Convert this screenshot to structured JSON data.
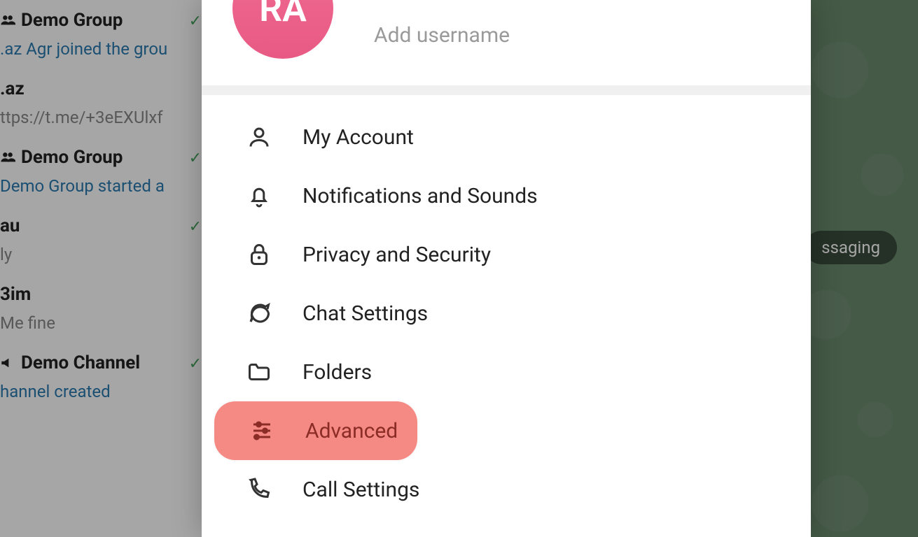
{
  "background": {
    "badge_text": "ssaging"
  },
  "chatlist": [
    {
      "icon": "group",
      "title": "Demo Group",
      "subtitle": ".az Agr joined the grou",
      "sub_color": "link",
      "check": true
    },
    {
      "icon": "",
      "title": ".az",
      "subtitle": "ttps://t.me/+3eEXUlxf",
      "sub_color": "gray",
      "check": false
    },
    {
      "icon": "group",
      "title": "Demo Group",
      "subtitle": "Demo Group started a",
      "sub_color": "link",
      "check": true
    },
    {
      "icon": "",
      "title": "au",
      "subtitle": "ly",
      "sub_color": "gray",
      "check": true
    },
    {
      "icon": "",
      "title": "3im",
      "subtitle": "Me fine",
      "sub_color": "gray",
      "check": false
    },
    {
      "icon": "channel",
      "title": "Demo Channel",
      "subtitle": "hannel created",
      "sub_color": "link",
      "check": true
    }
  ],
  "profile": {
    "avatar_initials": "RA",
    "username_placeholder": "Add username"
  },
  "menu": [
    {
      "key": "account",
      "icon": "person",
      "label": "My Account",
      "highlight": false
    },
    {
      "key": "notif",
      "icon": "bell",
      "label": "Notifications and Sounds",
      "highlight": false
    },
    {
      "key": "privacy",
      "icon": "lock",
      "label": "Privacy and Security",
      "highlight": false
    },
    {
      "key": "chat",
      "icon": "chat",
      "label": "Chat Settings",
      "highlight": false
    },
    {
      "key": "folders",
      "icon": "folder",
      "label": "Folders",
      "highlight": false
    },
    {
      "key": "advanced",
      "icon": "sliders",
      "label": "Advanced",
      "highlight": true
    },
    {
      "key": "calls",
      "icon": "phone",
      "label": "Call Settings",
      "highlight": false
    }
  ]
}
